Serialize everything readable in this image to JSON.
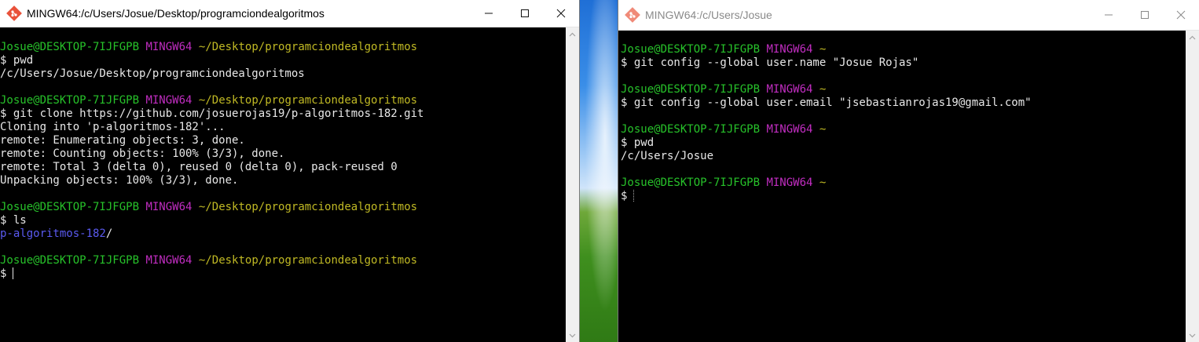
{
  "left_window": {
    "title": "MINGW64:/c/Users/Josue/Desktop/programciondealgoritmos",
    "lines": [
      {
        "user": "Josue@DESKTOP-7IJFGPB",
        "host": "MINGW64",
        "path": "~/Desktop/programciondealgoritmos"
      },
      {
        "text": "$ pwd"
      },
      {
        "text": "/c/Users/Josue/Desktop/programciondealgoritmos"
      },
      {
        "text": ""
      },
      {
        "user": "Josue@DESKTOP-7IJFGPB",
        "host": "MINGW64",
        "path": "~/Desktop/programciondealgoritmos"
      },
      {
        "text": "$ git clone https://github.com/josuerojas19/p-algoritmos-182.git"
      },
      {
        "text": "Cloning into 'p-algoritmos-182'..."
      },
      {
        "text": "remote: Enumerating objects: 3, done."
      },
      {
        "text": "remote: Counting objects: 100% (3/3), done."
      },
      {
        "text": "remote: Total 3 (delta 0), reused 0 (delta 0), pack-reused 0"
      },
      {
        "text": "Unpacking objects: 100% (3/3), done."
      },
      {
        "text": ""
      },
      {
        "user": "Josue@DESKTOP-7IJFGPB",
        "host": "MINGW64",
        "path": "~/Desktop/programciondealgoritmos"
      },
      {
        "text": "$ ls"
      },
      {
        "dir": "p-algoritmos-182",
        "suffix": "/"
      },
      {
        "text": ""
      },
      {
        "user": "Josue@DESKTOP-7IJFGPB",
        "host": "MINGW64",
        "path": "~/Desktop/programciondealgoritmos"
      },
      {
        "prompt": "$"
      }
    ]
  },
  "right_window": {
    "title": "MINGW64:/c/Users/Josue",
    "lines": [
      {
        "user": "Josue@DESKTOP-7IJFGPB",
        "host": "MINGW64",
        "path": "~"
      },
      {
        "text": "$ git config --global user.name \"Josue Rojas\""
      },
      {
        "text": ""
      },
      {
        "user": "Josue@DESKTOP-7IJFGPB",
        "host": "MINGW64",
        "path": "~"
      },
      {
        "text": "$ git config --global user.email \"jsebastianrojas19@gmail.com\""
      },
      {
        "text": ""
      },
      {
        "user": "Josue@DESKTOP-7IJFGPB",
        "host": "MINGW64",
        "path": "~"
      },
      {
        "text": "$ pwd"
      },
      {
        "text": "/c/Users/Josue"
      },
      {
        "text": ""
      },
      {
        "user": "Josue@DESKTOP-7IJFGPB",
        "host": "MINGW64",
        "path": "~"
      },
      {
        "prompt": "$"
      }
    ]
  },
  "colors": {
    "user": "#27c22a",
    "host": "#c12dc1",
    "path": "#c0b924",
    "text": "#e8e8e8",
    "directory": "#5a5af0",
    "terminal_bg": "#000000"
  },
  "icons": {
    "app": "git-bash-icon",
    "minimize": "minimize-icon",
    "maximize": "maximize-icon",
    "close": "close-icon"
  }
}
